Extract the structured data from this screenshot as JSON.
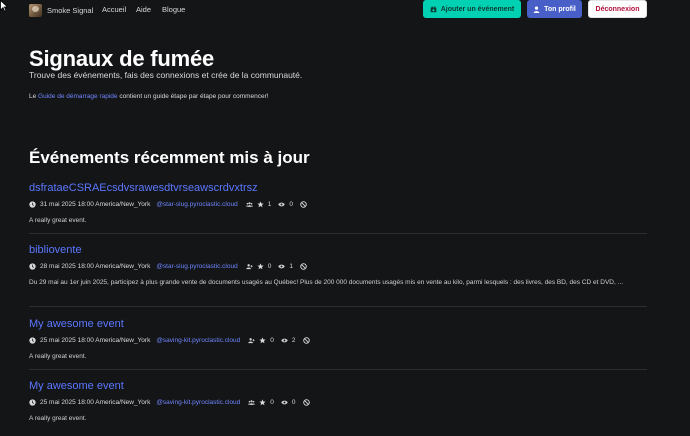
{
  "nav": {
    "brand": "Smoke Signal",
    "links": [
      "Accueil",
      "Aide",
      "Blogue"
    ],
    "add_event": "Ajouter un événement",
    "profile": "Ton profil",
    "logout": "Déconnexion"
  },
  "hero": {
    "title": "Signaux de fumée",
    "subtitle": "Trouve des événements, fais des connexions et crée de la communauté.",
    "guide_prefix": "Le ",
    "guide_link": "Guide de démarrage rapide",
    "guide_suffix": " contient un guide étape par étape pour commencer!"
  },
  "section": {
    "title": "Événements récemment mis à jour"
  },
  "events": [
    {
      "title": "dsfrataeCSRAEcsdvsrawesdtvrseawscrdvxtrsz",
      "date": "31 mai 2025 18:00 America/New_York",
      "handle": "@star-slug.pyroclastic.cloud",
      "group_icon": "users-icon",
      "stars": "1",
      "views": "0",
      "description": "A really great event."
    },
    {
      "title": "bibliovente",
      "date": "28 mai 2025 18:00 America/New_York",
      "handle": "@star-slug.pyroclastic.cloud",
      "group_icon": "user-plus-icon",
      "stars": "0",
      "views": "1",
      "description": "Du 29 mai au 1er juin 2025, participez à plus grande vente de documents usagés au Québec! Plus de 200 000 documents usagés mis en vente au kilo, parmi lesquels : des livres, des BD, des CD et DVD, ..."
    },
    {
      "title": "My awesome event",
      "date": "25 mai 2025 18:00 America/New_York",
      "handle": "@saving-kit.pyroclastic.cloud",
      "group_icon": "user-plus-icon",
      "stars": "0",
      "views": "2",
      "description": "A really great event."
    },
    {
      "title": "My awesome event",
      "date": "25 mai 2025 18:00 America/New_York",
      "handle": "@saving-kit.pyroclastic.cloud",
      "group_icon": "users-icon",
      "stars": "0",
      "views": "0",
      "description": "A really great event."
    }
  ]
}
